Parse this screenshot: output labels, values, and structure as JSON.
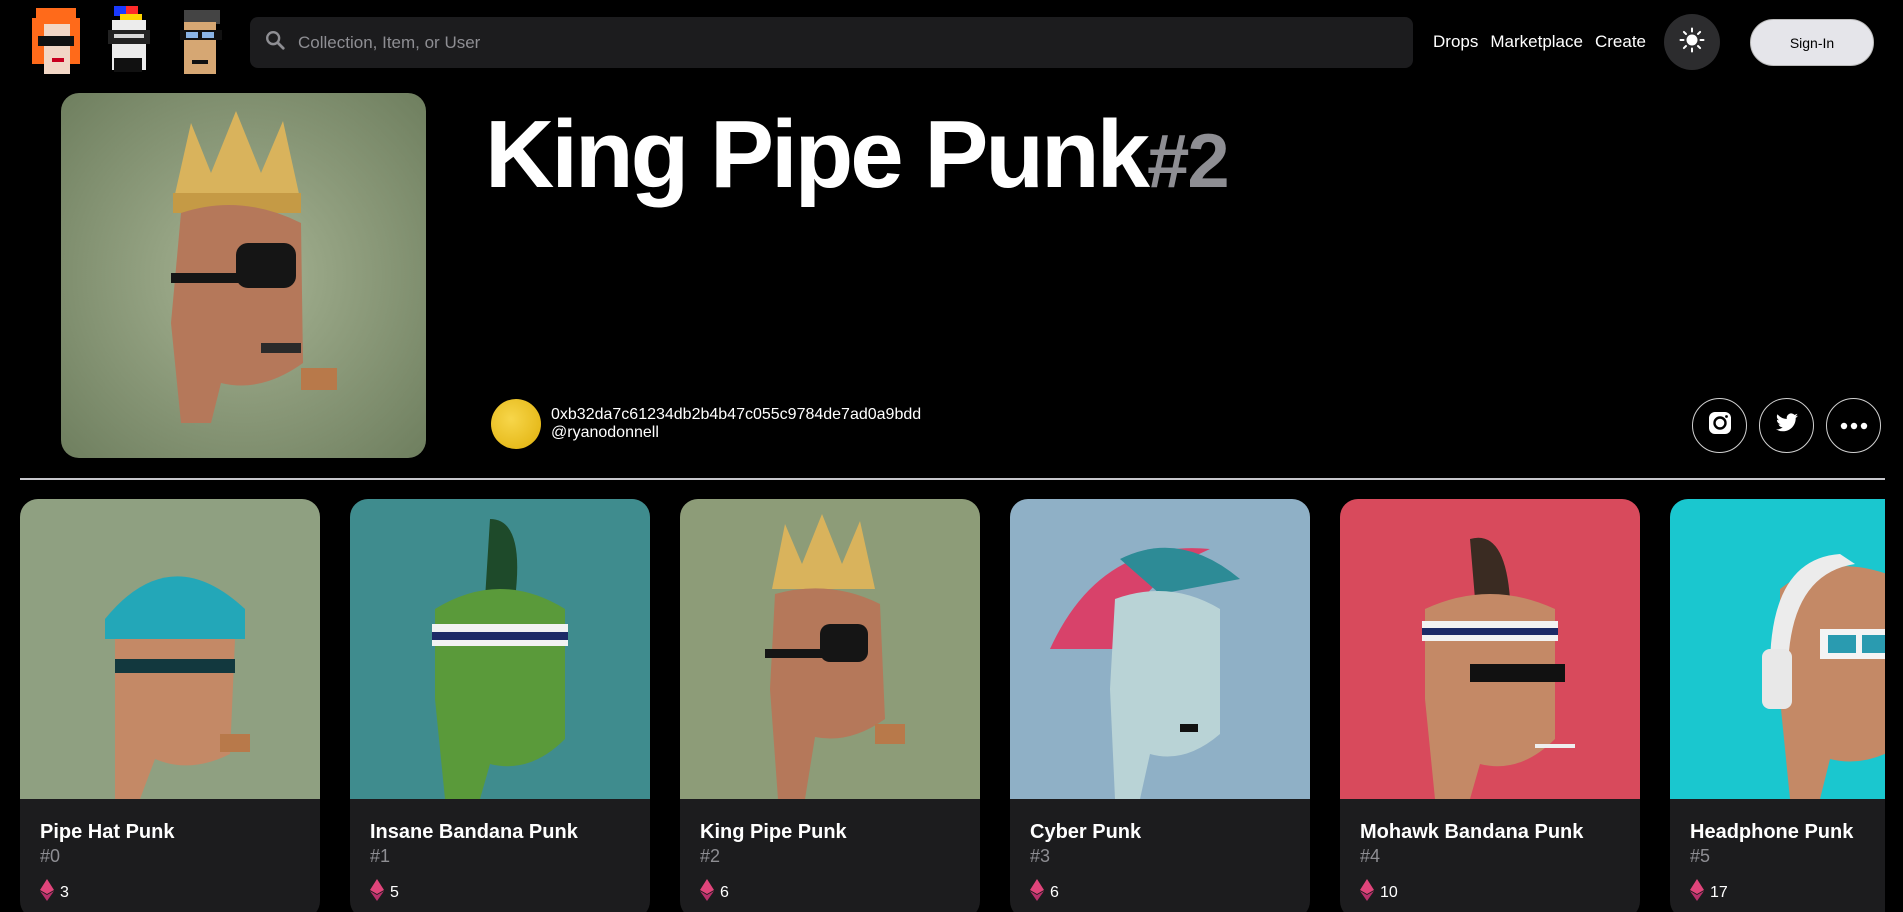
{
  "nav": {
    "search_placeholder": "Collection, Item, or User",
    "links": [
      "Drops",
      "Marketplace",
      "Create"
    ],
    "theme_icon": "sun-icon",
    "signin_label": "Sign-In"
  },
  "hero": {
    "title": "King Pipe Punk",
    "number": "#2",
    "owner_address": "0xb32da7c61234db2b4b47c055c9784de7ad0a9bdd",
    "owner_handle": "@ryanodonnell",
    "socials": [
      "instagram-icon",
      "twitter-icon",
      "more-icon"
    ]
  },
  "cards": [
    {
      "name": "Pipe Hat Punk",
      "number": "#0",
      "price": "3",
      "bg": "#8fa081"
    },
    {
      "name": "Insane Bandana Punk",
      "number": "#1",
      "price": "5",
      "bg": "#3f8c8e"
    },
    {
      "name": "King Pipe Punk",
      "number": "#2",
      "price": "6",
      "bg": "#8d9c78"
    },
    {
      "name": "Cyber Punk",
      "number": "#3",
      "price": "6",
      "bg": "#8fb0c6"
    },
    {
      "name": "Mohawk Bandana Punk",
      "number": "#4",
      "price": "10",
      "bg": "#d84a5c"
    },
    {
      "name": "Headphone Punk",
      "number": "#5",
      "price": "17",
      "bg": "#1ac7cf"
    }
  ],
  "colors": {
    "accent": "#e5e5ea",
    "muted": "#8e8e93",
    "eth": "#e0457b"
  }
}
